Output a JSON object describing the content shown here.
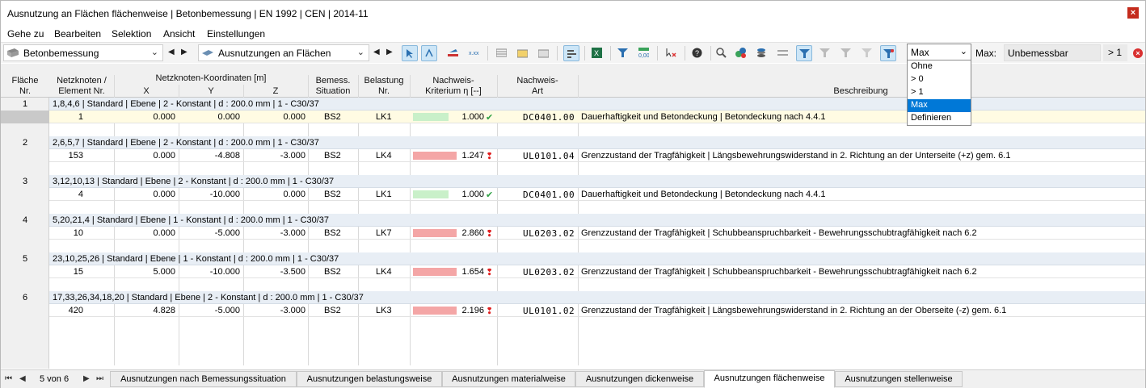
{
  "window": {
    "title": "Ausnutzung an Flächen flächenweise | Betonbemessung | EN 1992 | CEN | 2014-11",
    "close_label": "×"
  },
  "menu": [
    "Gehe zu",
    "Bearbeiten",
    "Selektion",
    "Ansicht",
    "Einstellungen"
  ],
  "toolbar": {
    "module_combo": "Betonbemessung",
    "view_combo": "Ausnutzungen an Flächen",
    "filter_combo": "Max",
    "max_label": "Max:",
    "max_value": "Unbemessbar",
    "gt_label": "> 1"
  },
  "dropdown": {
    "selected": "Max",
    "options": [
      "Ohne",
      "> 0",
      "> 1",
      "Max",
      "Definieren"
    ],
    "highlighted_index": 3
  },
  "header": {
    "flaeche": [
      "Fläche",
      "Nr."
    ],
    "netzknoten": [
      "Netzknoten /",
      "Element Nr."
    ],
    "koord_group": "Netzknoten-Koordinaten [m]",
    "x": "X",
    "y": "Y",
    "z": "Z",
    "bemess": [
      "Bemess.",
      "Situation"
    ],
    "belastung": [
      "Belastung",
      "Nr."
    ],
    "nachweis_krit": [
      "Nachweis-",
      "Kriterium η [--]"
    ],
    "nachweis_art": [
      "Nachweis-",
      "Art"
    ],
    "beschreibung": "Beschreibung"
  },
  "rows": [
    {
      "nr": "1",
      "desc": "1,8,4,6 | Standard | Ebene | 2 - Konstant | d : 200.0 mm | 1 - C30/37",
      "elem": "1",
      "x": "0.000",
      "y": "0.000",
      "z": "0.000",
      "bs": "BS2",
      "lk": "LK1",
      "eta": "1.000",
      "eta_value": 1.0,
      "ok": true,
      "art": "DC0401.00",
      "text": "Dauerhaftigkeit und Betondeckung | Betondeckung nach 4.4.1"
    },
    {
      "nr": "2",
      "desc": "2,6,5,7 | Standard | Ebene | 2 - Konstant | d : 200.0 mm | 1 - C30/37",
      "elem": "153",
      "x": "0.000",
      "y": "-4.808",
      "z": "-3.000",
      "bs": "BS2",
      "lk": "LK4",
      "eta": "1.247",
      "eta_value": 1.247,
      "ok": false,
      "art": "UL0101.04",
      "text": "Grenzzustand der Tragfähigkeit | Längsbewehrungswiderstand in 2. Richtung an der Unterseite (+z) gem. 6.1"
    },
    {
      "nr": "3",
      "desc": "3,12,10,13 | Standard | Ebene | 2 - Konstant | d : 200.0 mm | 1 - C30/37",
      "elem": "4",
      "x": "0.000",
      "y": "-10.000",
      "z": "0.000",
      "bs": "BS2",
      "lk": "LK1",
      "eta": "1.000",
      "eta_value": 1.0,
      "ok": true,
      "art": "DC0401.00",
      "text": "Dauerhaftigkeit und Betondeckung | Betondeckung nach 4.4.1"
    },
    {
      "nr": "4",
      "desc": "5,20,21,4 | Standard | Ebene | 1 - Konstant | d : 200.0 mm | 1 - C30/37",
      "elem": "10",
      "x": "0.000",
      "y": "-5.000",
      "z": "-3.000",
      "bs": "BS2",
      "lk": "LK7",
      "eta": "2.860",
      "eta_value": 2.86,
      "ok": false,
      "art": "UL0203.02",
      "text": "Grenzzustand der Tragfähigkeit | Schubbeanspruchbarkeit - Bewehrungsschubtragfähigkeit nach 6.2"
    },
    {
      "nr": "5",
      "desc": "23,10,25,26 | Standard | Ebene | 1 - Konstant | d : 200.0 mm | 1 - C30/37",
      "elem": "15",
      "x": "5.000",
      "y": "-10.000",
      "z": "-3.500",
      "bs": "BS2",
      "lk": "LK4",
      "eta": "1.654",
      "eta_value": 1.654,
      "ok": false,
      "art": "UL0203.02",
      "text": "Grenzzustand der Tragfähigkeit | Schubbeanspruchbarkeit - Bewehrungsschubtragfähigkeit nach 6.2"
    },
    {
      "nr": "6",
      "desc": "17,33,26,34,18,20 | Standard | Ebene | 2 - Konstant | d : 200.0 mm | 1 - C30/37",
      "elem": "420",
      "x": "4.828",
      "y": "-5.000",
      "z": "-3.000",
      "bs": "BS2",
      "lk": "LK3",
      "eta": "2.196",
      "eta_value": 2.196,
      "ok": false,
      "art": "UL0101.02",
      "text": "Grenzzustand der Tragfähigkeit | Längsbewehrungswiderstand in 2. Richtung an der Oberseite (-z) gem. 6.1"
    }
  ],
  "pager": {
    "label": "5 von 6"
  },
  "tabs": [
    "Ausnutzungen nach Bemessungssituation",
    "Ausnutzungen belastungsweise",
    "Ausnutzungen materialweise",
    "Ausnutzungen dickenweise",
    "Ausnutzungen flächenweise",
    "Ausnutzungen stellenweise"
  ],
  "active_tab": 4,
  "colors": {
    "ok_bar": "#c9f0c9",
    "bad_bar": "#f4a6a6",
    "highlight_option": "#0078d7"
  }
}
